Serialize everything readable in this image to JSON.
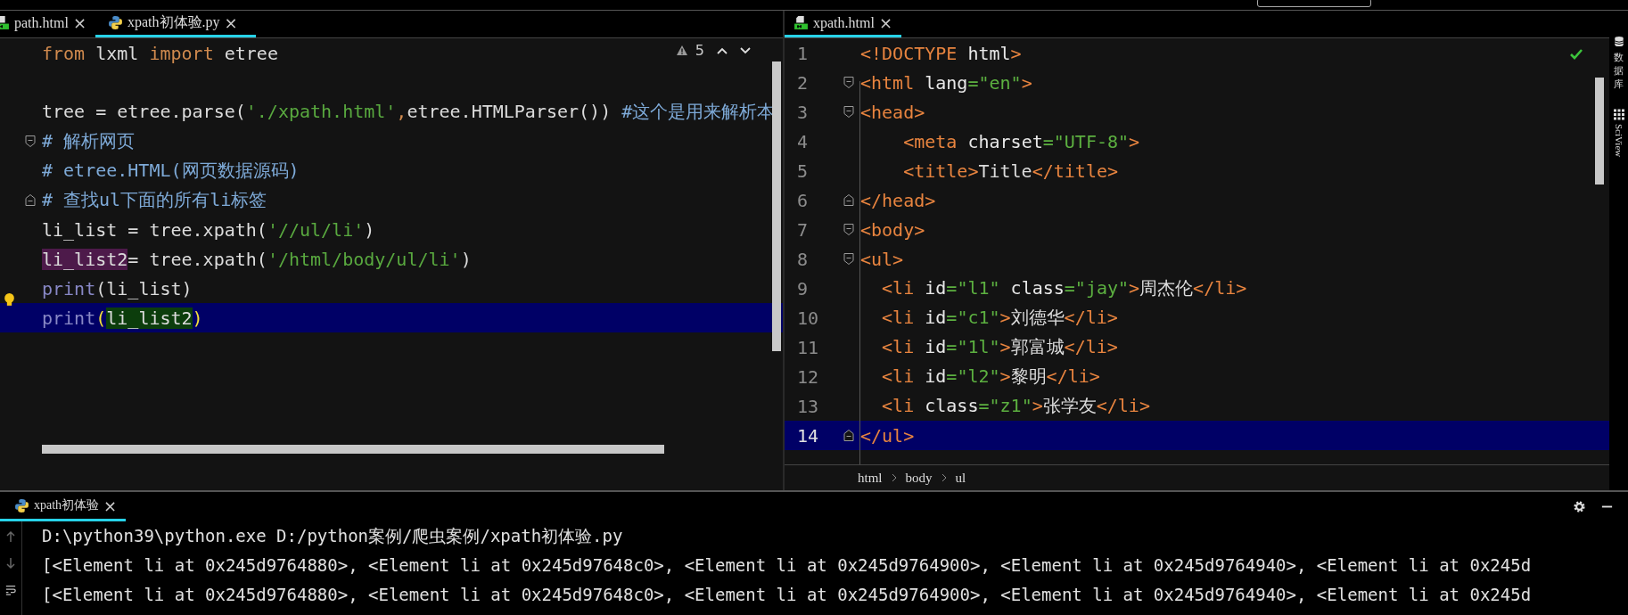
{
  "left_tabs": [
    {
      "label": "path.html",
      "kind": "html",
      "close": "×",
      "selected": false
    },
    {
      "label": "xpath初体验.py",
      "kind": "python",
      "close": "×",
      "selected": true
    }
  ],
  "left_editor": {
    "problem_count": "5",
    "lines": [
      {
        "fold_open": false,
        "fold_close": false,
        "current": false,
        "tokens": [
          {
            "kind": "keyword",
            "text": "from"
          },
          {
            "kind": "plain",
            "text": " lxml "
          },
          {
            "kind": "keyword",
            "text": "import"
          },
          {
            "kind": "plain",
            "text": " etree"
          }
        ]
      },
      {
        "fold_open": false,
        "fold_close": false,
        "current": false
      },
      {
        "fold_open": false,
        "fold_close": false,
        "current": false,
        "tokens": [
          {
            "kind": "plain",
            "text": "tree = etree.parse("
          },
          {
            "kind": "string",
            "text": "'./xpath.html'"
          },
          {
            "kind": "keyword",
            "text": ","
          },
          {
            "kind": "plain",
            "text": "etree.HTMLParser()) "
          },
          {
            "kind": "comment",
            "text": "#这个是用来解析本"
          }
        ]
      },
      {
        "fold_open": true,
        "fold_close": false,
        "current": false,
        "tokens": [
          {
            "kind": "comment",
            "text": "# 解析网页"
          }
        ]
      },
      {
        "fold_open": false,
        "fold_close": false,
        "current": false,
        "tokens": [
          {
            "kind": "comment",
            "text": "# etree.HTML(网页数据源码)"
          }
        ]
      },
      {
        "fold_open": false,
        "fold_close": true,
        "current": false,
        "tokens": [
          {
            "kind": "comment",
            "text": "# 查找ul下面的所有li标签"
          }
        ]
      },
      {
        "fold_open": false,
        "fold_close": false,
        "current": false,
        "tokens": [
          {
            "kind": "plain",
            "text": "li_list = tree.xpath("
          },
          {
            "kind": "string",
            "text": "'//ul/li'"
          },
          {
            "kind": "plain",
            "text": ")"
          }
        ]
      },
      {
        "fold_open": false,
        "fold_close": false,
        "current": false,
        "tokens": [
          {
            "kind": "usage",
            "text": "li_list2"
          },
          {
            "kind": "plain",
            "text": "= tree.xpath("
          },
          {
            "kind": "string",
            "text": "'/html/body/ul/li'"
          },
          {
            "kind": "plain",
            "text": ")"
          }
        ]
      },
      {
        "fold_open": false,
        "fold_close": false,
        "current": false,
        "bulb": true,
        "tokens": [
          {
            "kind": "builtin",
            "text": "print"
          },
          {
            "kind": "plain",
            "text": "(li_list)"
          }
        ]
      },
      {
        "fold_open": false,
        "fold_close": false,
        "current": true,
        "tokens": [
          {
            "kind": "builtin",
            "text": "print"
          },
          {
            "kind": "brace",
            "text": "("
          },
          {
            "kind": "match",
            "text": "li_list2"
          },
          {
            "kind": "brace",
            "text": ")"
          }
        ]
      }
    ]
  },
  "right_tabs": [
    {
      "label": "xpath.html",
      "kind": "html",
      "close": "×",
      "selected": true
    }
  ],
  "right_editor": {
    "lines": [
      {
        "number": "1",
        "fold_open": false,
        "fold_close": false,
        "current": false,
        "tokens": [
          {
            "kind": "tag",
            "text": "<!DOCTYPE "
          },
          {
            "kind": "attr",
            "text": "html"
          },
          {
            "kind": "tag",
            "text": ">"
          }
        ]
      },
      {
        "number": "2",
        "fold_open": true,
        "fold_close": false,
        "current": false,
        "tokens": [
          {
            "kind": "tag",
            "text": "<html "
          },
          {
            "kind": "attr",
            "text": "lang"
          },
          {
            "kind": "value",
            "text": "=\"en\""
          },
          {
            "kind": "tag",
            "text": ">"
          }
        ]
      },
      {
        "number": "3",
        "fold_open": true,
        "fold_close": false,
        "current": false,
        "tokens": [
          {
            "kind": "tag",
            "text": "<head>"
          }
        ]
      },
      {
        "number": "4",
        "fold_open": false,
        "fold_close": false,
        "current": false,
        "tokens": [
          {
            "kind": "tag",
            "text": "    <meta "
          },
          {
            "kind": "attr",
            "text": "charset"
          },
          {
            "kind": "value",
            "text": "=\"UTF-8\""
          },
          {
            "kind": "tag",
            "text": ">"
          }
        ]
      },
      {
        "number": "5",
        "fold_open": false,
        "fold_close": false,
        "current": false,
        "tokens": [
          {
            "kind": "tag",
            "text": "    <title>"
          },
          {
            "kind": "plain",
            "text": "Title"
          },
          {
            "kind": "tag",
            "text": "</title>"
          }
        ]
      },
      {
        "number": "6",
        "fold_open": false,
        "fold_close": true,
        "current": false,
        "tokens": [
          {
            "kind": "tag",
            "text": "</head>"
          }
        ]
      },
      {
        "number": "7",
        "fold_open": true,
        "fold_close": false,
        "current": false,
        "tokens": [
          {
            "kind": "tag",
            "text": "<body>"
          }
        ]
      },
      {
        "number": "8",
        "fold_open": true,
        "fold_close": false,
        "current": false,
        "tokens": [
          {
            "kind": "tag",
            "text": "<ul>"
          }
        ]
      },
      {
        "number": "9",
        "fold_open": false,
        "fold_close": false,
        "current": false,
        "tokens": [
          {
            "kind": "tag",
            "text": "  <li "
          },
          {
            "kind": "attr",
            "text": "id"
          },
          {
            "kind": "value",
            "text": "=\"l1\""
          },
          {
            "kind": "attr",
            "text": " class"
          },
          {
            "kind": "value",
            "text": "=\"jay\""
          },
          {
            "kind": "tag",
            "text": ">"
          },
          {
            "kind": "plain",
            "text": "周杰伦"
          },
          {
            "kind": "tag",
            "text": "</li>"
          }
        ]
      },
      {
        "number": "10",
        "fold_open": false,
        "fold_close": false,
        "current": false,
        "tokens": [
          {
            "kind": "tag",
            "text": "  <li "
          },
          {
            "kind": "attr",
            "text": "id"
          },
          {
            "kind": "value",
            "text": "=\"c1\""
          },
          {
            "kind": "tag",
            "text": ">"
          },
          {
            "kind": "plain",
            "text": "刘德华"
          },
          {
            "kind": "tag",
            "text": "</li>"
          }
        ]
      },
      {
        "number": "11",
        "fold_open": false,
        "fold_close": false,
        "current": false,
        "tokens": [
          {
            "kind": "tag",
            "text": "  <li "
          },
          {
            "kind": "attr",
            "text": "id"
          },
          {
            "kind": "value",
            "text": "=\"1l\""
          },
          {
            "kind": "tag",
            "text": ">"
          },
          {
            "kind": "plain",
            "text": "郭富城"
          },
          {
            "kind": "tag",
            "text": "</li>"
          }
        ]
      },
      {
        "number": "12",
        "fold_open": false,
        "fold_close": false,
        "current": false,
        "tokens": [
          {
            "kind": "tag",
            "text": "  <li "
          },
          {
            "kind": "attr",
            "text": "id"
          },
          {
            "kind": "value",
            "text": "=\"l2\""
          },
          {
            "kind": "tag",
            "text": ">"
          },
          {
            "kind": "plain",
            "text": "黎明"
          },
          {
            "kind": "tag",
            "text": "</li>"
          }
        ]
      },
      {
        "number": "13",
        "fold_open": false,
        "fold_close": false,
        "current": false,
        "tokens": [
          {
            "kind": "tag",
            "text": "  <li "
          },
          {
            "kind": "attr",
            "text": "class"
          },
          {
            "kind": "value",
            "text": "=\"z1\""
          },
          {
            "kind": "tag",
            "text": ">"
          },
          {
            "kind": "plain",
            "text": "张学友"
          },
          {
            "kind": "tag",
            "text": "</li>"
          }
        ]
      },
      {
        "number": "14",
        "fold_open": false,
        "fold_close": true,
        "current": true,
        "tokens": [
          {
            "kind": "tag",
            "text": "</ul>"
          }
        ]
      }
    ],
    "breadcrumb": [
      "html",
      "body",
      "ul"
    ]
  },
  "side_tools": [
    {
      "label": "数据库",
      "kind": "database"
    },
    {
      "label": "SciView",
      "kind": "grid"
    }
  ],
  "run_panel": {
    "tab": {
      "label": "xpath初体验",
      "close": "×",
      "selected": true
    },
    "output": [
      "D:\\python39\\python.exe D:/python案例/爬虫案例/xpath初体验.py",
      "[<Element li at 0x245d9764880>, <Element li at 0x245d97648c0>, <Element li at 0x245d9764900>, <Element li at 0x245d9764940>, <Element li at 0x245d",
      "[<Element li at 0x245d9764880>, <Element li at 0x245d97648c0>, <Element li at 0x245d9764900>, <Element li at 0x245d9764940>, <Element li at 0x245d"
    ]
  }
}
